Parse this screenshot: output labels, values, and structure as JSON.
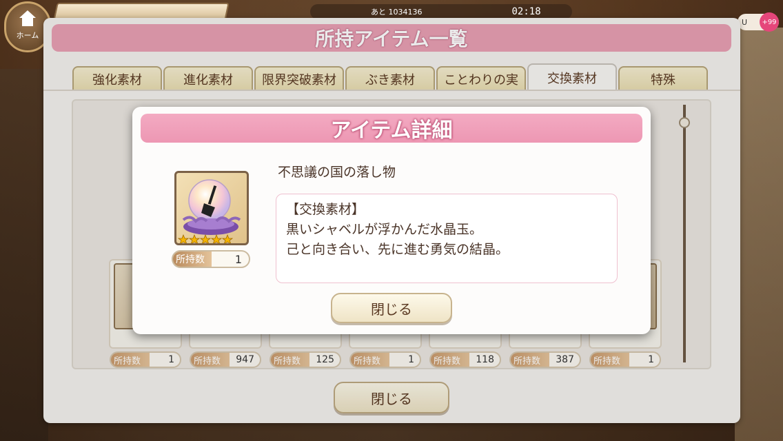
{
  "top_bar": {
    "home_label": "ホーム",
    "remain_label": "あと 1034136",
    "time": "02:18",
    "notif_count": "+99"
  },
  "main_panel": {
    "title": "所持アイテム一覧",
    "tabs": [
      {
        "label": "強化素材"
      },
      {
        "label": "進化素材"
      },
      {
        "label": "限界突破素材"
      },
      {
        "label": "ぶき素材"
      },
      {
        "label": "ことわりの実"
      },
      {
        "label": "交換素材"
      },
      {
        "label": "特殊"
      }
    ],
    "active_tab": "交換素材",
    "count_label": "所持数",
    "bottom_row_counts": [
      "1",
      "947",
      "125",
      "1",
      "118",
      "387",
      "1"
    ],
    "close_label": "閉じる"
  },
  "modal": {
    "title": "アイテム詳細",
    "item_name": "不思議の国の落し物",
    "item_icon": "crystal-ball-shovel-icon",
    "stars": 5,
    "owned_label": "所持数",
    "owned_count": "1",
    "description": [
      "【交換素材】",
      "黒いシャベルが浮かんだ水晶玉。",
      "己と向き合い、先に進む勇気の結晶。"
    ],
    "close_label": "閉じる"
  },
  "colors": {
    "title_pink": "#ed97b3",
    "text_brown": "#5b3a23",
    "star_gold": "#f5b400"
  }
}
